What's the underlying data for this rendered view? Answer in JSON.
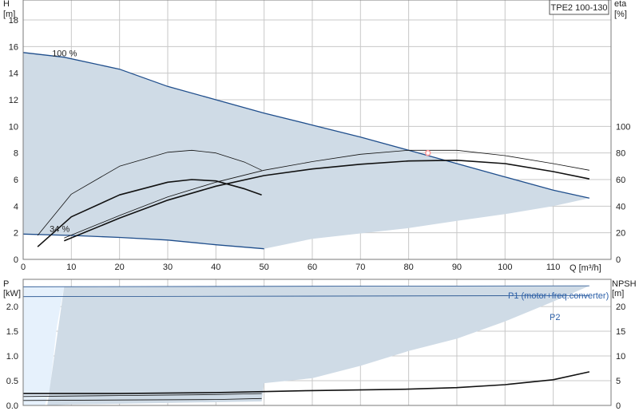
{
  "model_label": "TPE2 100-130",
  "colors": {
    "envelope_fill": "#cfdbe6",
    "light_region_fill": "#e6f1fc",
    "envelope_line": "#1f4e8c",
    "curve": "#111111",
    "operating_point": "#ff9a9a",
    "accent_text": "#2b5fa8"
  },
  "chart_data": [
    {
      "type": "line",
      "name": "head-efficiency",
      "xlabel": "Q [m³/h]",
      "ylabel_left_line1": "H",
      "ylabel_left_line2": "[m]",
      "ylabel_right_line1": "eta",
      "ylabel_right_line2": "[%]",
      "xlim": [
        0,
        122
      ],
      "ylim": [
        0,
        19.5
      ],
      "ylim_right": [
        0,
        195
      ],
      "xticks": [
        0,
        10,
        20,
        30,
        40,
        50,
        60,
        70,
        80,
        90,
        100,
        110
      ],
      "yticks_left": [
        0,
        2,
        4,
        6,
        8,
        10,
        12,
        14,
        16,
        18
      ],
      "yticks_right": [
        0,
        20,
        40,
        60,
        80,
        100
      ],
      "grid": true,
      "annotations": [
        {
          "text": "100 %",
          "x": 6.0,
          "y": 15.4
        },
        {
          "text": "34 %",
          "x": 5.5,
          "y": 2.2
        }
      ],
      "operating_point": {
        "x": 84.0,
        "y": 8.0
      },
      "light_region": [
        [
          0,
          15.55
        ],
        [
          8.5,
          15.2
        ],
        [
          4.5,
          9.0
        ],
        [
          2.5,
          2.0
        ],
        [
          0,
          1.9
        ]
      ],
      "envelope": {
        "upper": [
          [
            0,
            15.55
          ],
          [
            8.5,
            15.2
          ],
          [
            20,
            14.3
          ],
          [
            30,
            13.0
          ],
          [
            40,
            12.0
          ],
          [
            50,
            11.0
          ],
          [
            60,
            10.1
          ],
          [
            70,
            9.2
          ],
          [
            80,
            8.2
          ],
          [
            90,
            7.2
          ],
          [
            100,
            6.2
          ],
          [
            110,
            5.2
          ],
          [
            117.5,
            4.6
          ]
        ],
        "lower": [
          [
            117.5,
            4.6
          ],
          [
            110,
            4.0
          ],
          [
            100,
            3.4
          ],
          [
            90,
            2.9
          ],
          [
            80,
            2.35
          ],
          [
            70,
            1.95
          ],
          [
            60,
            1.55
          ],
          [
            50,
            0.8
          ],
          [
            40,
            1.1
          ],
          [
            30,
            1.45
          ],
          [
            20,
            1.65
          ],
          [
            10,
            1.8
          ],
          [
            0,
            1.9
          ]
        ]
      },
      "series": [
        {
          "role": "curve-100-eta",
          "weight": "thin",
          "values": [
            [
              8.5,
              1.6
            ],
            [
              20,
              3.3
            ],
            [
              30,
              4.7
            ],
            [
              40,
              5.8
            ],
            [
              50,
              6.7
            ],
            [
              60,
              7.35
            ],
            [
              70,
              7.9
            ],
            [
              80,
              8.2
            ],
            [
              90,
              8.2
            ],
            [
              100,
              7.8
            ],
            [
              110,
              7.2
            ],
            [
              117.5,
              6.7
            ]
          ]
        },
        {
          "role": "curve-100-head",
          "weight": "thick",
          "values": [
            [
              8.5,
              1.4
            ],
            [
              20,
              3.1
            ],
            [
              30,
              4.45
            ],
            [
              40,
              5.5
            ],
            [
              50,
              6.3
            ],
            [
              60,
              6.8
            ],
            [
              70,
              7.15
            ],
            [
              80,
              7.4
            ],
            [
              90,
              7.45
            ],
            [
              100,
              7.2
            ],
            [
              110,
              6.6
            ],
            [
              117.5,
              6.05
            ]
          ]
        },
        {
          "role": "curve-34-eta",
          "weight": "thin",
          "values": [
            [
              3.0,
              1.8
            ],
            [
              10,
              4.9
            ],
            [
              20,
              7.0
            ],
            [
              30,
              8.05
            ],
            [
              35,
              8.2
            ],
            [
              40,
              8.0
            ],
            [
              46,
              7.3
            ],
            [
              49.5,
              6.7
            ]
          ]
        },
        {
          "role": "curve-34-head",
          "weight": "thick",
          "values": [
            [
              3.0,
              0.95
            ],
            [
              10,
              3.2
            ],
            [
              20,
              4.85
            ],
            [
              30,
              5.8
            ],
            [
              35,
              6.0
            ],
            [
              40,
              5.9
            ],
            [
              46,
              5.3
            ],
            [
              49.5,
              4.85
            ]
          ]
        }
      ]
    },
    {
      "type": "line",
      "name": "power-npsh",
      "ylabel_left_line1": "P",
      "ylabel_left_line2": "[kW]",
      "ylabel_right_line1": "NPSH",
      "ylabel_right_line2": "[m]",
      "xlim": [
        0,
        122
      ],
      "ylim": [
        0,
        2.55
      ],
      "ylim_right": [
        0,
        25.5
      ],
      "yticks_left": [
        0.0,
        0.5,
        1.0,
        1.5,
        2.0
      ],
      "ytick_labels_left": [
        "0.0",
        "0.5",
        "1.0",
        "1.5",
        "2.0"
      ],
      "yticks_right": [
        0,
        5,
        10,
        15,
        20
      ],
      "grid": true,
      "light_region": [
        [
          0,
          2.4
        ],
        [
          8.5,
          2.4
        ],
        [
          7.0,
          1.6
        ],
        [
          5.5,
          0.3
        ],
        [
          4.5,
          0.0
        ],
        [
          0,
          0.0
        ]
      ],
      "envelope": {
        "upper": [
          [
            8.5,
            2.4
          ],
          [
            30,
            2.4
          ],
          [
            60,
            2.41
          ],
          [
            90,
            2.42
          ],
          [
            117.5,
            2.42
          ]
        ],
        "lower": [
          [
            117.5,
            2.42
          ],
          [
            110,
            2.1
          ],
          [
            100,
            1.7
          ],
          [
            90,
            1.35
          ],
          [
            80,
            1.1
          ],
          [
            70,
            0.8
          ],
          [
            60,
            0.55
          ],
          [
            50,
            0.45
          ],
          [
            49.5,
            0.08
          ],
          [
            30,
            0.05
          ],
          [
            10,
            0.02
          ],
          [
            5,
            0.0
          ]
        ]
      },
      "labels": {
        "p1": "P1 (motor+freq.converter)",
        "p2": "P2"
      },
      "series": [
        {
          "role": "P1",
          "weight": "thin",
          "values": [
            [
              0,
              2.4
            ],
            [
              117.5,
              2.42
            ]
          ]
        },
        {
          "role": "P2",
          "weight": "thin",
          "values": [
            [
              0,
              2.2
            ],
            [
              117.5,
              2.22
            ]
          ]
        },
        {
          "role": "npsh-100",
          "weight": "thick",
          "values": [
            [
              0,
              0.24
            ],
            [
              20,
              0.24
            ],
            [
              40,
              0.26
            ],
            [
              60,
              0.3
            ],
            [
              80,
              0.33
            ],
            [
              90,
              0.36
            ],
            [
              100,
              0.42
            ],
            [
              110,
              0.52
            ],
            [
              117.5,
              0.68
            ]
          ]
        },
        {
          "role": "npsh-34",
          "weight": "thin",
          "values": [
            [
              0,
              0.18
            ],
            [
              20,
              0.2
            ],
            [
              40,
              0.22
            ],
            [
              49.5,
              0.24
            ]
          ]
        },
        {
          "role": "npsh-34b",
          "weight": "thin",
          "values": [
            [
              0,
              0.1
            ],
            [
              20,
              0.11
            ],
            [
              40,
              0.12
            ],
            [
              49.5,
              0.14
            ]
          ]
        }
      ]
    }
  ]
}
